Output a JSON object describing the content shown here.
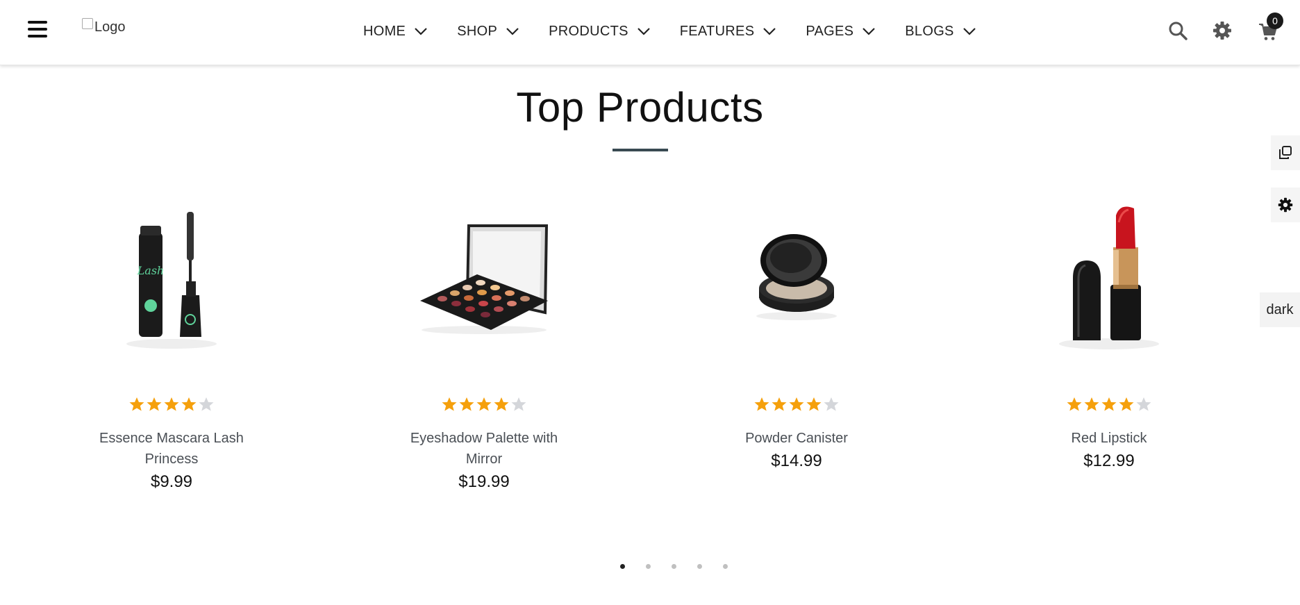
{
  "header": {
    "logo_alt": "Logo",
    "nav": [
      {
        "label": "HOME"
      },
      {
        "label": "SHOP"
      },
      {
        "label": "PRODUCTS"
      },
      {
        "label": "FEATURES"
      },
      {
        "label": "PAGES"
      },
      {
        "label": "BLOGS"
      }
    ],
    "icons": {
      "search": "search-icon",
      "settings": "gear-icon",
      "cart": "cart-icon"
    },
    "cart_count": "0"
  },
  "section": {
    "title": "Top Products"
  },
  "side": {
    "dark_label": "dark"
  },
  "products": [
    {
      "name": "Essence Mascara Lash Princess",
      "price": "$9.99",
      "rating": 4,
      "rating_max": 5
    },
    {
      "name": "Eyeshadow Palette with Mirror",
      "price": "$19.99",
      "rating": 4,
      "rating_max": 5
    },
    {
      "name": "Powder Canister",
      "price": "$14.99",
      "rating": 4,
      "rating_max": 5
    },
    {
      "name": "Red Lipstick",
      "price": "$12.99",
      "rating": 4,
      "rating_max": 5
    }
  ],
  "carousel": {
    "pages": 5,
    "active": 0
  },
  "colors": {
    "star_filled": "#f5a00c",
    "star_empty": "#d4d6da",
    "accent_underline": "#394a52"
  }
}
